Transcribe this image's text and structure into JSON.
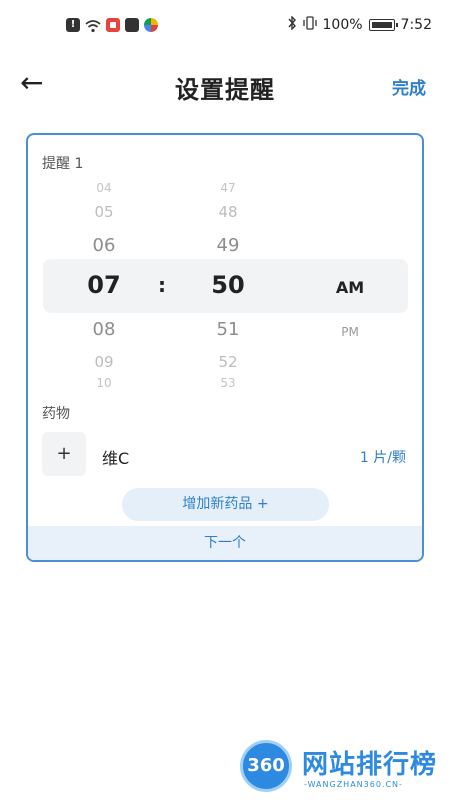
{
  "status_bar": {
    "battery": "100%",
    "time": "7:52",
    "left_icons": [
      "alert-icon",
      "wifi-icon",
      "red-app-icon",
      "mail-icon",
      "color-app-icon"
    ],
    "right_icons": [
      "bluetooth-icon",
      "vibrate-icon",
      "battery-icon"
    ]
  },
  "header": {
    "back": "←",
    "title": "设置提醒",
    "done": "完成"
  },
  "reminder": {
    "label": "提醒 1",
    "hours": [
      "04",
      "05",
      "06",
      "07",
      "08",
      "09",
      "10"
    ],
    "minutes": [
      "47",
      "48",
      "49",
      "50",
      "51",
      "52",
      "53"
    ],
    "colon": ":",
    "am": "AM",
    "pm": "PM"
  },
  "medicine": {
    "label": "药物",
    "add_symbol": "+",
    "name": "维C",
    "dose": "1 片/颗",
    "add_new": "增加新药品 +",
    "next": "下一个"
  },
  "watermark": {
    "badge": "360",
    "text": "网站排行榜",
    "sub": "-WANGZHAN360.CN-"
  },
  "colors": {
    "accent": "#2f7fc8",
    "card_border": "#4a8fd4",
    "selected_band": "#f2f3f5"
  }
}
